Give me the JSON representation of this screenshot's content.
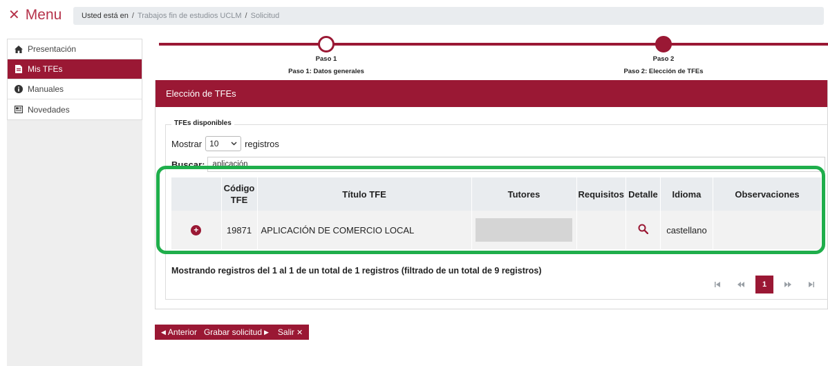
{
  "app": {
    "menu_label": "Menu",
    "brand_color": "#9a1834",
    "highlight_color": "#1fae4b"
  },
  "breadcrumb": {
    "label": "Usted está en",
    "separator": "/",
    "items": [
      "Trabajos fin de estudios UCLM",
      "Solicitud"
    ]
  },
  "sidebar": {
    "items": [
      {
        "label": "Presentación",
        "icon": "home-icon",
        "active": false
      },
      {
        "label": "Mis TFEs",
        "icon": "document-icon",
        "active": true
      },
      {
        "label": "Manuales",
        "icon": "info-icon",
        "active": false
      },
      {
        "label": "Novedades",
        "icon": "news-icon",
        "active": false
      }
    ]
  },
  "stepper": {
    "steps": [
      {
        "name": "Paso 1",
        "title": "Paso 1: Datos generales",
        "state": "current"
      },
      {
        "name": "Paso 2",
        "title": "Paso 2: Elección de TFEs",
        "state": "completed"
      }
    ]
  },
  "panel": {
    "title": "Elección de TFEs",
    "legend": "TFEs disponibles",
    "length_prefix": "Mostrar",
    "length_value": "10",
    "length_suffix": "registros",
    "search_label": "Buscar:",
    "search_value": "aplicación"
  },
  "table": {
    "headers": [
      "",
      "Código TFE",
      "Título TFE",
      "Tutores",
      "Requisitos",
      "Detalle",
      "Idioma",
      "Observaciones"
    ],
    "rows": [
      {
        "code": "19871",
        "title": "APLICACIÓN DE COMERCIO LOCAL",
        "tutores": "",
        "requisitos": "",
        "idioma": "castellano",
        "observaciones": ""
      }
    ]
  },
  "info_text": "Mostrando registros del 1 al 1 de un total de 1 registros (filtrado de un total de 9 registros)",
  "pagination": {
    "current_page": "1"
  },
  "actions": {
    "previous": "Anterior",
    "save": "Grabar solicitud",
    "exit": "Salir"
  }
}
